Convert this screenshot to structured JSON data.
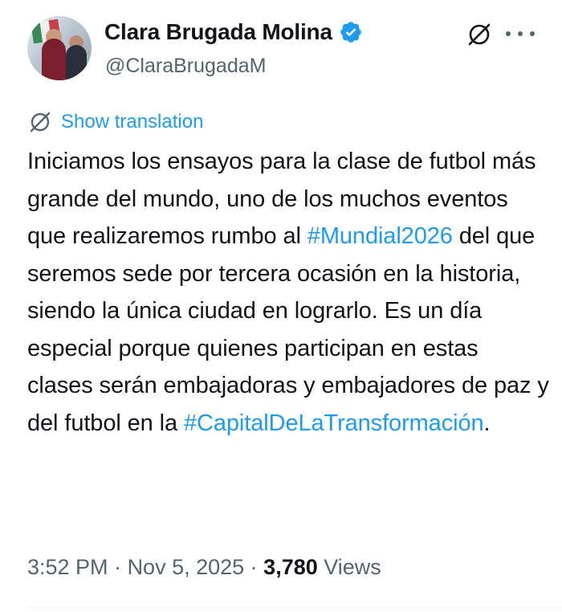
{
  "author": {
    "display_name": "Clara Brugada Molina",
    "handle": "@ClaraBrugadaM",
    "verified": true
  },
  "actions": {
    "grok_icon": "grok-icon",
    "more_icon": "more-horizontal-icon"
  },
  "translate": {
    "label": "Show translation"
  },
  "tweet": {
    "line1": "Iniciamos los ensayos para la clase de futbol más grande del mundo, uno de los muchos eventos que realizaremos rumbo al ",
    "hashtag1": "#Mundial2026",
    "line2": " del que seremos sede por tercera ocasión en la historia, siendo la única ciudad en lograrlo. Es un día especial porque quienes participan en estas clases serán embajadoras y embajadores de paz y del futbol en la ",
    "hashtag2": "#CapitalDeLaTransformación",
    "end": "."
  },
  "meta": {
    "time": "3:52 PM",
    "sep1": " · ",
    "date": "Nov 5, 2025",
    "sep2": " · ",
    "views_count": "3,780",
    "views_label": " Views"
  },
  "colors": {
    "accent": "#1d9bf0",
    "text": "#0f1419",
    "secondary": "#536471"
  }
}
